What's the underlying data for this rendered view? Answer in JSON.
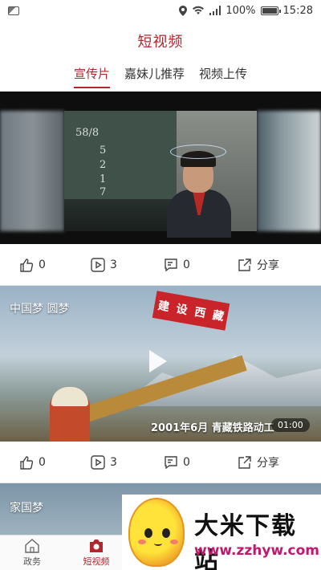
{
  "status_bar": {
    "battery": "100%",
    "time": "15:28",
    "battery_level": 1.0
  },
  "header": {
    "title": "短视频"
  },
  "tabs": [
    {
      "label": "宣传片",
      "active": true
    },
    {
      "label": "嘉妹儿推荐",
      "active": false
    },
    {
      "label": "视频上传",
      "active": false
    }
  ],
  "videos": [
    {
      "board_text": [
        "58/8",
        "5",
        "2",
        "1",
        "7"
      ],
      "likes": "0",
      "plays": "3",
      "comments": "0",
      "share_label": "分享"
    },
    {
      "overlay_title": "中国梦 圆梦",
      "sign_text": [
        "建",
        "设",
        "西",
        "藏"
      ],
      "caption": "2001年6月  青藏铁路动工",
      "duration": "01:00",
      "likes": "0",
      "plays": "3",
      "comments": "0",
      "share_label": "分享"
    },
    {
      "overlay_title": "家国梦"
    }
  ],
  "bottom_nav": [
    {
      "label": "政务",
      "icon": "home-icon",
      "active": false
    },
    {
      "label": "短视频",
      "icon": "camera-icon",
      "active": true
    }
  ],
  "watermark": {
    "title": "大米下载站",
    "url": "www.zzhyw.com"
  },
  "colors": {
    "accent": "#b3262d",
    "text": "#333333"
  }
}
